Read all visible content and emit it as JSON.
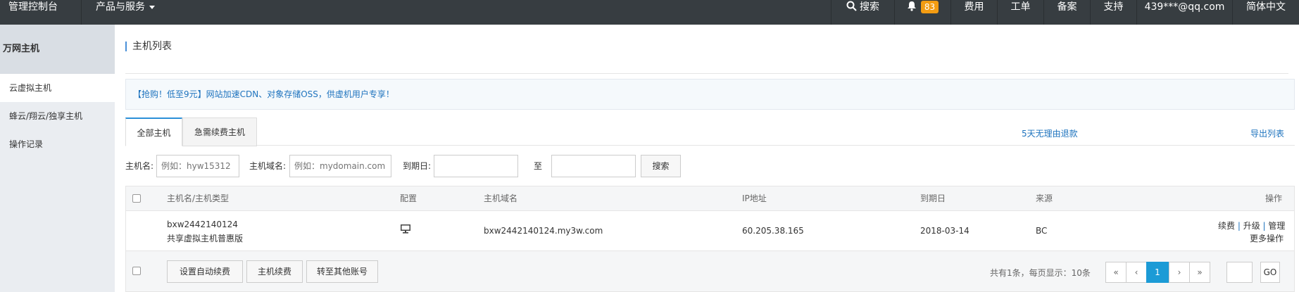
{
  "topbar": {
    "brand": "管理控制台",
    "products": "产品与服务",
    "search": "搜索",
    "notifications": "83",
    "fees": "费用",
    "tickets": "工单",
    "filing": "备案",
    "support": "支持",
    "account": "439***@qq.com",
    "language": "简体中文"
  },
  "sidebar": {
    "title": "万网主机",
    "items": [
      {
        "label": "云虚拟主机"
      },
      {
        "label": "蜂云/翔云/独享主机"
      },
      {
        "label": "操作记录"
      }
    ]
  },
  "main": {
    "title": "主机列表",
    "promo": "【抢购！低至9元】网站加速CDN、对象存储OSS，供虚机用户专享！",
    "tabs": [
      {
        "label": "全部主机"
      },
      {
        "label": "急需续费主机"
      }
    ],
    "refund_link": "5天无理由退款",
    "export_link": "导出列表",
    "filter": {
      "host_label": "主机名:",
      "host_placeholder": "例如：hyw15312",
      "domain_label": "主机域名:",
      "domain_placeholder": "例如：mydomain.com",
      "expire_label": "到期日:",
      "to": "至",
      "search_button": "搜索"
    },
    "table": {
      "headers": [
        "主机名/主机类型",
        "配置",
        "主机域名",
        "IP地址",
        "到期日",
        "来源",
        "操作"
      ],
      "rows": [
        {
          "host": "bxw2442140124",
          "type": "共享虚拟主机普惠版",
          "domain": "bxw2442140124.my3w.com",
          "ip": "60.205.38.165",
          "expire": "2018-03-14",
          "source": "BC",
          "actions": [
            "续费",
            "升级",
            "管理"
          ],
          "more": "更多操作"
        }
      ]
    },
    "footer": {
      "auto_renew": "设置自动续费",
      "renew": "主机续费",
      "transfer": "转至其他账号",
      "summary": "共有1条，每页显示：10条",
      "first": "«",
      "prev": "‹",
      "page": "1",
      "next": "›",
      "last": "»",
      "go": "GO"
    }
  }
}
